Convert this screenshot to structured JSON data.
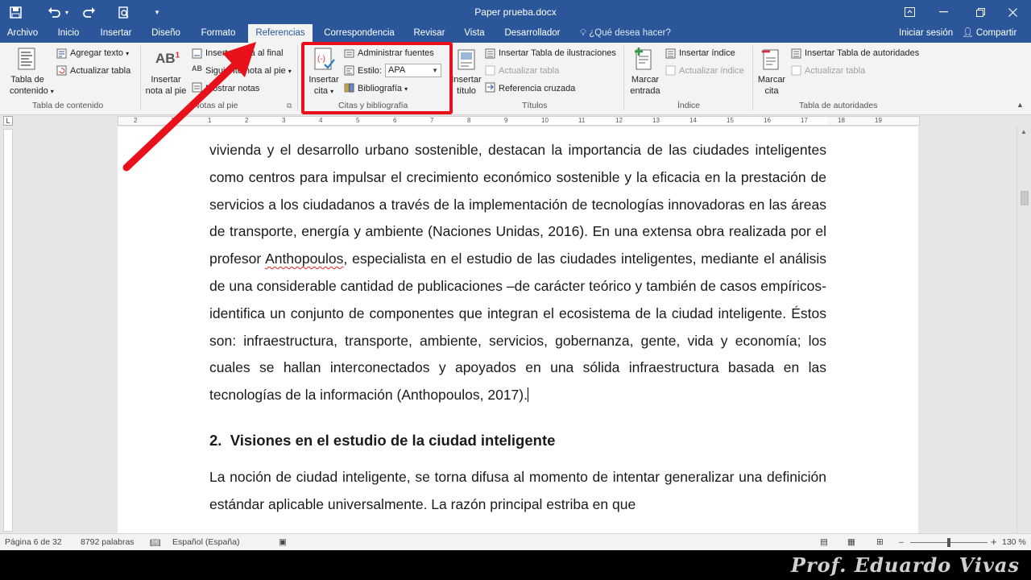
{
  "window": {
    "doc_title": "Paper prueba.docx"
  },
  "tabs": [
    {
      "label": "Archivo"
    },
    {
      "label": "Inicio"
    },
    {
      "label": "Insertar"
    },
    {
      "label": "Diseño"
    },
    {
      "label": "Formato"
    },
    {
      "label": "Referencias",
      "active": true
    },
    {
      "label": "Correspondencia"
    },
    {
      "label": "Revisar"
    },
    {
      "label": "Vista"
    },
    {
      "label": "Desarrollador"
    }
  ],
  "tell_me": "¿Qué desea hacer?",
  "account": {
    "signin": "Iniciar sesión",
    "share": "Compartir"
  },
  "ribbon": {
    "toc": {
      "big_button_line1": "Tabla de",
      "big_button_line2": "contenido",
      "add_text": "Agregar texto",
      "update_table": "Actualizar tabla",
      "group_label": "Tabla de contenido"
    },
    "footnotes": {
      "big_button_line1": "Insertar",
      "big_button_line2": "nota al pie",
      "insert_endnote": "Insertar nota al final",
      "next_footnote": "Siguiente nota al pie",
      "show_notes": "Mostrar notas",
      "group_label": "Notas al pie"
    },
    "citations": {
      "big_button_line1": "Insertar",
      "big_button_line2": "cita",
      "manage_sources": "Administrar fuentes",
      "style_label": "Estilo:",
      "style_value": "APA",
      "bibliography": "Bibliografía",
      "group_label": "Citas y bibliografía"
    },
    "captions": {
      "big_button_line1": "Insertar",
      "big_button_line2": "título",
      "insert_table_figures": "Insertar Tabla de ilustraciones",
      "update_table": "Actualizar tabla",
      "cross_reference": "Referencia cruzada",
      "group_label": "Títulos"
    },
    "index": {
      "big_button_line1": "Marcar",
      "big_button_line2": "entrada",
      "insert_index": "Insertar índice",
      "update_index": "Actualizar índice",
      "group_label": "Índice"
    },
    "authorities": {
      "big_button_line1": "Marcar",
      "big_button_line2": "cita",
      "insert_table_auth": "Insertar Tabla de autoridades",
      "update_table": "Actualizar tabla",
      "group_label": "Tabla de autoridades"
    }
  },
  "ruler": {
    "tab_selector": "L",
    "numbers": [
      "2",
      "1",
      "1",
      "2",
      "3",
      "4",
      "5",
      "6",
      "7",
      "8",
      "9",
      "10",
      "11",
      "12",
      "13",
      "14",
      "15",
      "16",
      "17",
      "18",
      "19"
    ]
  },
  "document": {
    "para1_a": "vivienda y el desarrollo urbano sostenible, destacan la importancia de las ciudades inteligentes como centros para impulsar el crecimiento económico sostenible y la eficacia en la prestación de servicios a los ciudadanos a través de la implementación de tecnologías innovadoras en las áreas de transporte, energía y ambiente (Naciones Unidas, 2016). En una extensa obra realizada por el profesor ",
    "para1_name": "Anthopoulos",
    "para1_b": ", especialista en el estudio de las ciudades inteligentes, mediante el análisis de una considerable cantidad de publicaciones –de carácter teórico y también de casos empíricos- identifica un conjunto de componentes que integran el ecosistema de la ciudad inteligente. Éstos son: infraestructura, transporte, ambiente, servicios, gobernanza, gente, vida y economía; los cuales se hallan interconectados y apoyados en una sólida infraestructura basada en las tecnologías de la información (Anthopoulos, 2017).",
    "heading_num": "2.",
    "heading_text": "Visiones en el estudio de la ciudad inteligente",
    "para2": "La noción de ciudad inteligente, se torna difusa al momento de intentar generalizar una definición estándar aplicable universalmente. La razón principal estriba en que"
  },
  "status": {
    "page": "Página 6 de 32",
    "words": "8792 palabras",
    "language": "Español (España)",
    "zoom": "130 %",
    "zoom_minus": "–",
    "zoom_plus": "+"
  },
  "watermark": "Prof.  Eduardo Vivas",
  "colors": {
    "word_blue": "#2b579a",
    "annotation_red": "#e8101a"
  }
}
